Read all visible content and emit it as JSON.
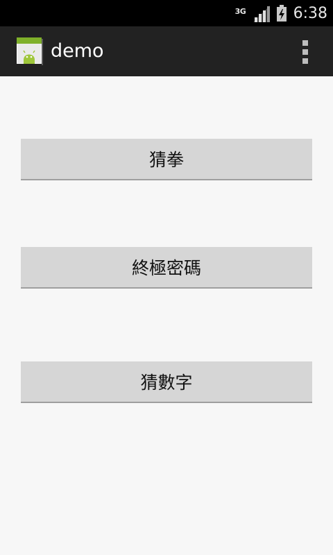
{
  "status_bar": {
    "network_type": "3G",
    "time": "6:38",
    "icons": [
      "signal-icon",
      "battery-icon"
    ]
  },
  "action_bar": {
    "title": "demo",
    "app_icon": "android-app-icon",
    "menu_icon": "overflow-menu-icon"
  },
  "buttons": [
    {
      "label": "猜拳"
    },
    {
      "label": "終極密碼"
    },
    {
      "label": "猜數字"
    }
  ],
  "colors": {
    "status_bar_bg": "#000000",
    "action_bar_bg": "#222222",
    "content_bg": "#f7f7f7",
    "button_bg": "#d6d6d6",
    "button_text": "#111111"
  }
}
